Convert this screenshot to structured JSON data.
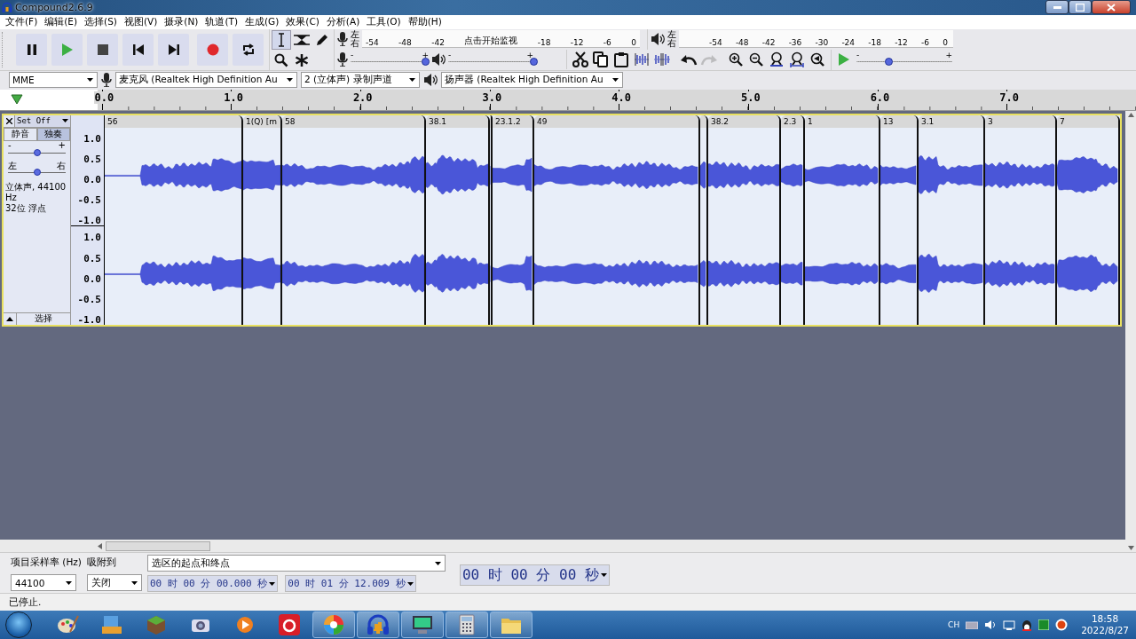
{
  "window": {
    "title": "Compound2.6.9"
  },
  "menu": [
    "文件(F)",
    "编辑(E)",
    "选择(S)",
    "视图(V)",
    "摄录(N)",
    "轨道(T)",
    "生成(G)",
    "效果(C)",
    "分析(A)",
    "工具(O)",
    "帮助(H)"
  ],
  "transport": [
    {
      "kind": "pause"
    },
    {
      "kind": "play"
    },
    {
      "kind": "stop"
    },
    {
      "kind": "skip-start"
    },
    {
      "kind": "skip-end"
    },
    {
      "kind": "record"
    },
    {
      "kind": "loop"
    }
  ],
  "tools": [
    {
      "kind": "select",
      "selected": true
    },
    {
      "kind": "envelope",
      "selected": false
    },
    {
      "kind": "draw",
      "selected": false
    },
    {
      "kind": "zoom",
      "selected": false
    },
    {
      "kind": "multi",
      "selected": false
    }
  ],
  "record_meter": {
    "channels": [
      "左",
      "右"
    ],
    "ticks_before": [
      "-54",
      "-48",
      "-42"
    ],
    "hint": "点击开始监视",
    "ticks_after": [
      "-18",
      "-12",
      "-6",
      "0"
    ]
  },
  "play_meter": {
    "channels": [
      "左",
      "右"
    ],
    "ticks": [
      "-54",
      "-48",
      "-42",
      "-36",
      "-30",
      "-24",
      "-18",
      "-12",
      "-6",
      "0"
    ]
  },
  "mixer": {
    "min_label": "-",
    "max_label": "+",
    "record_volume": {
      "level": 0.95
    },
    "play_volume": {
      "level": 1.0
    }
  },
  "edit_tools": [
    {
      "kind": "cut",
      "disabled": false
    },
    {
      "kind": "copy",
      "disabled": false
    },
    {
      "kind": "paste",
      "disabled": false
    },
    {
      "kind": "trim",
      "disabled": false
    },
    {
      "kind": "silence",
      "disabled": false
    },
    {
      "kind": "undo",
      "disabled": false
    },
    {
      "kind": "redo",
      "disabled": true
    },
    {
      "kind": "zoom-in",
      "disabled": false
    },
    {
      "kind": "zoom-out",
      "disabled": false
    },
    {
      "kind": "fit-selection",
      "disabled": false
    },
    {
      "kind": "fit-project",
      "disabled": false
    },
    {
      "kind": "zoom-toggle",
      "disabled": false
    }
  ],
  "play_at_speed": {
    "min_label": "-",
    "max_label": "+",
    "level": 0.33
  },
  "device": {
    "host": "MME",
    "input": "麦克风 (Realtek High Definition Au",
    "channels": "2 (立体声) 录制声道",
    "output": "扬声器 (Realtek High Definition Au"
  },
  "ruler": {
    "labels": [
      "0.0",
      "1.0",
      "2.0",
      "3.0",
      "4.0",
      "5.0",
      "6.0",
      "7.0"
    ]
  },
  "track": {
    "name": "Set Off",
    "selected": true,
    "mute": {
      "label": "静音",
      "on": false
    },
    "solo": {
      "label": "独奏",
      "on": true
    },
    "gain": {
      "min_label": "-",
      "max_label": "+",
      "level": 0.5
    },
    "pan": {
      "min_label": "左",
      "max_label": "右",
      "level": 0.5
    },
    "info": [
      "立体声, 44100 Hz",
      "32位 浮点"
    ],
    "select_label": "选择",
    "channels": [
      {
        "scale": [
          "1.0",
          "0.5",
          "0.0",
          "-0.5",
          "-1.0"
        ]
      },
      {
        "scale": [
          "1.0",
          "0.5",
          "0.0",
          "-0.5",
          "-1.0"
        ]
      }
    ],
    "clips": [
      {
        "kind": "clip",
        "label": "56"
      },
      {
        "kind": "clip",
        "label": "1(Q) [m"
      },
      {
        "kind": "clip",
        "label": "58"
      },
      {
        "kind": "clip",
        "label": "38.1"
      },
      {
        "kind": "sliver"
      },
      {
        "kind": "clip",
        "label": "23.1.2"
      },
      {
        "kind": "clip",
        "label": "49"
      },
      {
        "kind": "sliver"
      },
      {
        "kind": "clip",
        "label": "38.2"
      },
      {
        "kind": "clip",
        "label": "2.3"
      },
      {
        "kind": "clip",
        "label": "1"
      },
      {
        "kind": "clip",
        "label": "13"
      },
      {
        "kind": "clip",
        "label": "3.1"
      },
      {
        "kind": "clip",
        "label": "3"
      },
      {
        "kind": "clip",
        "label": "7"
      }
    ]
  },
  "selection_toolbar": {
    "rate_label": "项目采样率 (Hz)",
    "rate": "44100",
    "snap_label": "吸附到",
    "snap": "关闭",
    "mode": "选区的起点和终点",
    "start": "00 时 00 分 00.000 秒",
    "end": "00 时 01 分 12.009 秒"
  },
  "time_display": "00 时 00 分 00 秒",
  "status_bar": {
    "text": "已停止."
  },
  "taskbar": {
    "apps": [
      {
        "kind": "paint",
        "running": false
      },
      {
        "kind": "folder-tree",
        "running": false
      },
      {
        "kind": "block",
        "running": false
      },
      {
        "kind": "camera",
        "running": false
      },
      {
        "kind": "media",
        "running": false
      },
      {
        "kind": "red-app",
        "running": false
      },
      {
        "kind": "color-wheel",
        "running": true
      },
      {
        "kind": "headphones",
        "running": true
      },
      {
        "kind": "monitor",
        "running": true
      },
      {
        "kind": "calculator",
        "running": true
      },
      {
        "kind": "folder",
        "running": true
      }
    ],
    "tray": {
      "language": "CH",
      "time": "18:58",
      "date": "2022/8/27"
    }
  }
}
